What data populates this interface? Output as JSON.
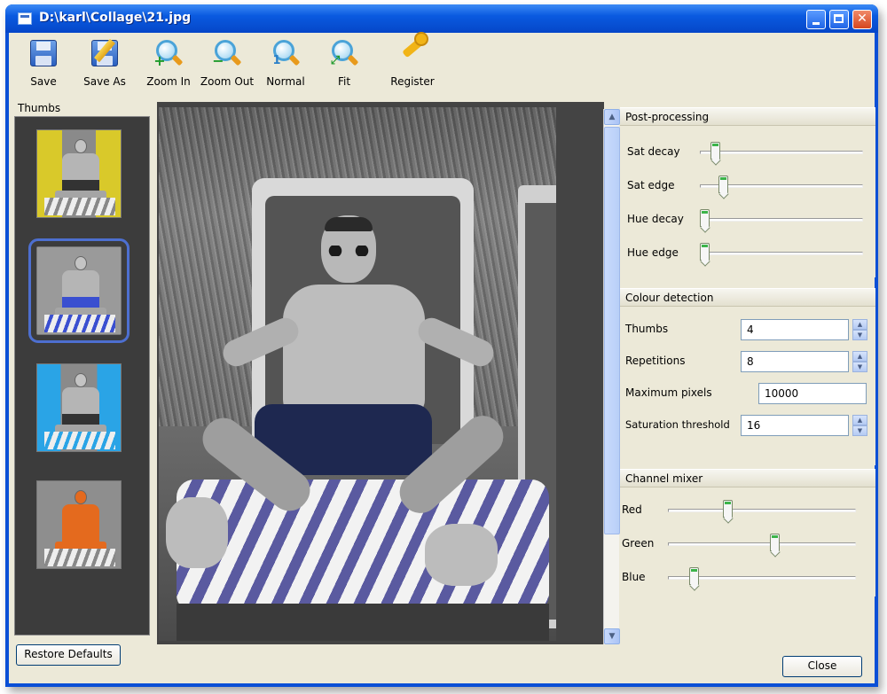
{
  "window": {
    "title": "D:\\karl\\Collage\\21.jpg",
    "controls": [
      "minimize",
      "maximize",
      "close"
    ]
  },
  "toolbar": {
    "buttons": [
      {
        "label": "Save",
        "icon": "floppy-disk-icon"
      },
      {
        "label": "Save As",
        "icon": "save-as-icon"
      },
      {
        "label": "Zoom In",
        "icon": "zoom-in-icon"
      },
      {
        "label": "Zoom Out",
        "icon": "zoom-out-icon"
      },
      {
        "label": "Normal",
        "icon": "zoom-normal-icon"
      },
      {
        "label": "Fit",
        "icon": "zoom-fit-icon"
      },
      {
        "label": "Register",
        "icon": "key-icon"
      }
    ]
  },
  "thumbs": {
    "header": "Thumbs",
    "items": [
      {
        "tint": "#d9c92a",
        "selected": false
      },
      {
        "tint": "#3a4fd0",
        "selected": true
      },
      {
        "tint": "#2aa4e6",
        "selected": false
      },
      {
        "tint": "#e46a1e",
        "selected": false
      }
    ]
  },
  "post_processing": {
    "title": "Post-processing",
    "sliders": [
      {
        "label": "Sat decay",
        "value": 0.07
      },
      {
        "label": "Sat edge",
        "value": 0.12
      },
      {
        "label": "Hue decay",
        "value": 0.0
      },
      {
        "label": "Hue edge",
        "value": 0.0
      }
    ]
  },
  "colour_detection": {
    "title": "Colour detection",
    "fields": [
      {
        "label": "Thumbs",
        "value": "4",
        "spinner": true
      },
      {
        "label": "Repetitions",
        "value": "8",
        "spinner": true
      },
      {
        "label": "Maximum pixels",
        "value": "10000",
        "spinner": false
      },
      {
        "label": "Saturation threshold",
        "value": "16",
        "spinner": true
      }
    ]
  },
  "channel_mixer": {
    "title": "Channel mixer",
    "sliders": [
      {
        "label": "Red",
        "value": 0.31
      },
      {
        "label": "Green",
        "value": 0.57
      },
      {
        "label": "Blue",
        "value": 0.12
      }
    ]
  },
  "footer": {
    "restore_label": "Restore Defaults",
    "close_label": "Close"
  },
  "colors": {
    "title_bar": "#0a5ae0",
    "client_bg": "#ece9d8",
    "slider_accent": "#3cb44a",
    "selection": "#4d6fd0"
  }
}
